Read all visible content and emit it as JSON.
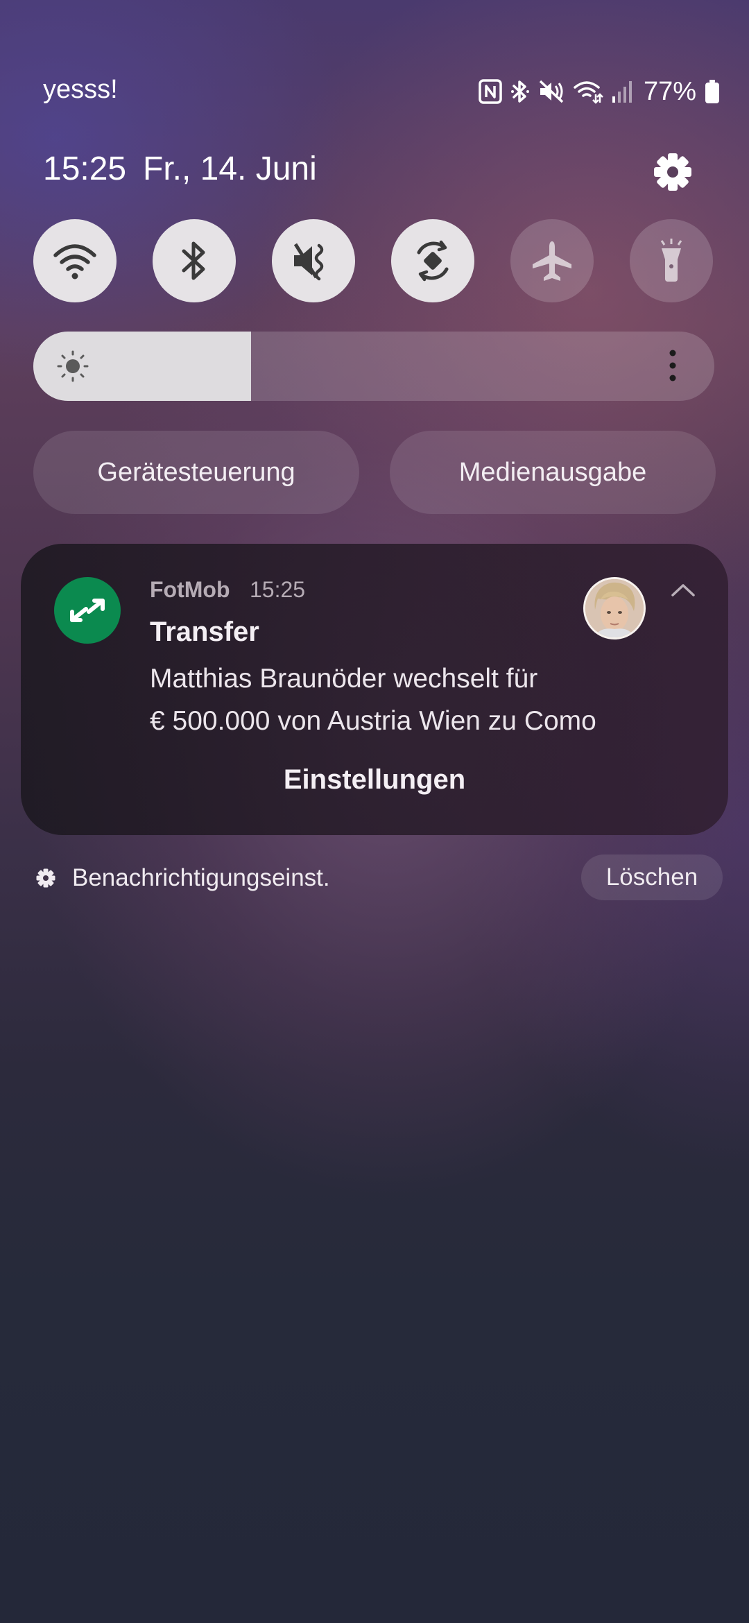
{
  "status_bar": {
    "carrier": "yesss!",
    "battery_percent": "77%",
    "icons": [
      "nfc-icon",
      "bluetooth-icon",
      "mute-icon",
      "wifi-icon",
      "signal-icon",
      "battery-icon"
    ]
  },
  "header": {
    "time": "15:25",
    "date": "Fr., 14. Juni"
  },
  "quick_tiles": [
    {
      "name": "wifi",
      "icon": "wifi-icon",
      "state": "on"
    },
    {
      "name": "bluetooth",
      "icon": "bluetooth-icon",
      "state": "on"
    },
    {
      "name": "mute",
      "icon": "mute-icon",
      "state": "on"
    },
    {
      "name": "auto-rotate",
      "icon": "rotate-icon",
      "state": "on"
    },
    {
      "name": "airplane",
      "icon": "airplane-icon",
      "state": "off"
    },
    {
      "name": "flashlight",
      "icon": "flashlight-icon",
      "state": "off"
    }
  ],
  "brightness": {
    "level": 0.32
  },
  "buttons": {
    "device_control": "Gerätesteuerung",
    "media_output": "Medienausgabe"
  },
  "notification": {
    "app_name": "FotMob",
    "time": "15:25",
    "title": "Transfer",
    "body_line1": "Matthias Braunöder wechselt für",
    "body_line2": "€ 500.000 von Austria Wien zu Como",
    "action": "Einstellungen",
    "app_color": "#0b8a4f"
  },
  "footer": {
    "notification_settings": "Benachrichtigungseinst.",
    "clear": "Löschen"
  }
}
